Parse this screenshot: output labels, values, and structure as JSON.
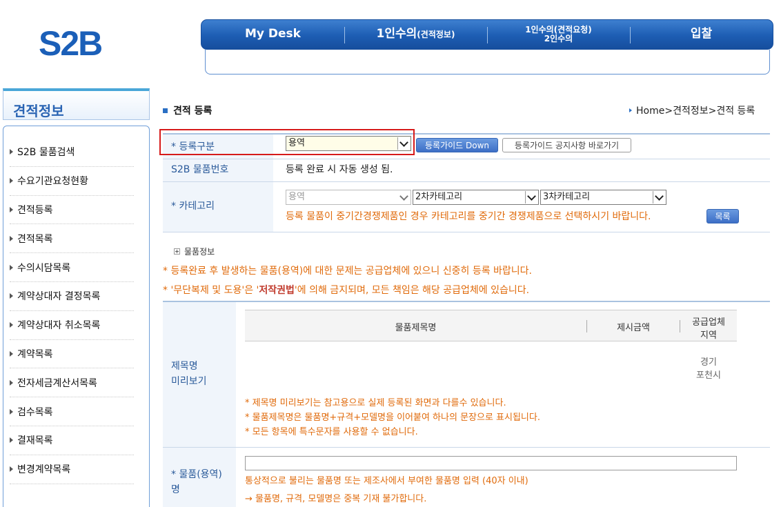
{
  "logo": "S2B",
  "topnav": {
    "items": [
      "My Desk",
      "1인수의",
      "(견적정보)",
      "1인수의(견적요청)",
      "2인수의",
      "입찰"
    ]
  },
  "sidebar": {
    "title": "견적정보",
    "items": [
      "S2B 물품검색",
      "수요기관요청현황",
      "견적등록",
      "견적목록",
      "수의시담목록",
      "계약상대자 결정목록",
      "계약상대자 취소목록",
      "계약목록",
      "전자세금계산서목록",
      "검수목록",
      "결재목록",
      "변경계약목록"
    ]
  },
  "page": {
    "title": "견적 등록",
    "breadcrumb": "Home>견적정보>견적 등록"
  },
  "form": {
    "reg_type_label": "* 등록구분",
    "reg_type_value": "용역",
    "guide_down_btn": "등록가이드 Down",
    "guide_notice_btn": "등록가이드 공지사항 바로가기",
    "item_no_label": "S2B 물품번호",
    "item_no_value": "등록 완료 시 자동 생성 됨.",
    "category_label": "* 카테고리",
    "category1": "용역",
    "category2": "2차카테고리",
    "category3": "3차카테고리",
    "category_note": "등록 물품이 중기간경쟁제품인 경우 카테고리를 중기간 경쟁제품으로 선택하시기 바랍니다.",
    "list_btn": "목록",
    "item_info": "물품정보",
    "notice1": "* 등록완료 후 발생하는 물품(용역)에 대한 문제는 공급업체에 있으니 신중히 등록 바랍니다.",
    "notice2_pre": "* '무단복제 및 도용'은 '",
    "notice2_bold": "저작권법",
    "notice2_post": "'에 의해 금지되며, 모든 책임은 해당 공급업체에 있습니다.",
    "preview_label_1": "제목명",
    "preview_label_2": "미리보기",
    "preview_col_name": "물품제목명",
    "preview_col_price": "제시금액",
    "preview_col_region_1": "공급업체",
    "preview_col_region_2": "지역",
    "preview_region_1": "경기",
    "preview_region_2": "포천시",
    "preview_note1": "* 제목명 미리보기는 참고용으로 실제 등록된 화면과 다를수 있습니다.",
    "preview_note2": "* 물품제목명은 물품명+규격+모델명을 이어붙여 하나의 문장으로 표시됩니다.",
    "preview_note3": "* 모든 항목에 특수문자를 사용할 수 없습니다.",
    "item_name_label_1": "* 물품(용역)",
    "item_name_label_2": "명",
    "item_name_value": "",
    "item_name_note": "통상적으로 불리는 물품명 또는 제조사에서 부여한 물품명 입력 (40자 이내)",
    "item_name_note2": "→ 물품명, 규격, 모델명은 중복 기재 불가합니다."
  }
}
